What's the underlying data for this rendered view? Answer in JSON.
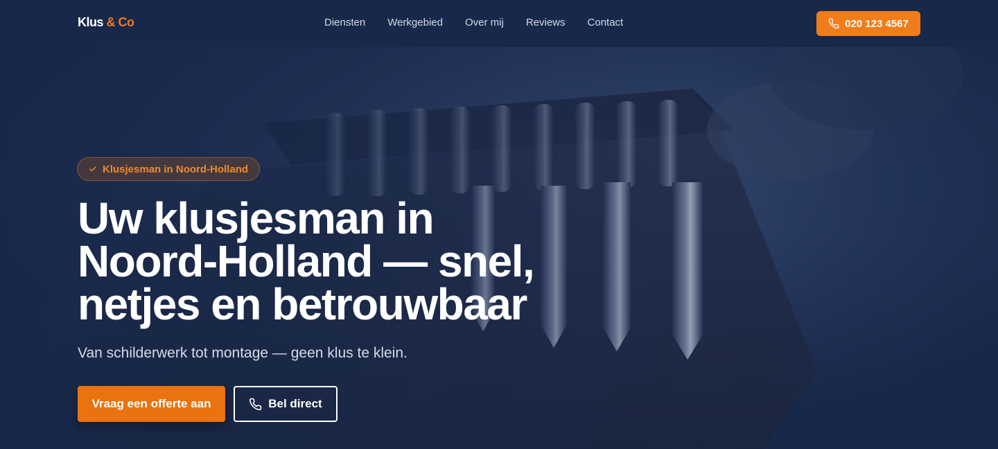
{
  "brand": {
    "logo_main": "Klus",
    "logo_accent": "& Co",
    "accent_color": "#f07c1a",
    "navy_color": "#17284a"
  },
  "nav": {
    "links": [
      "Diensten",
      "Werkgebied",
      "Over mij",
      "Reviews",
      "Contact"
    ],
    "phone_label": "020 123 4567",
    "phone_icon": "phone-icon"
  },
  "hero": {
    "badge": "Klusjesman in Noord-Holland",
    "badge_icon": "check-icon",
    "headline": "Uw klusjesman in Noord-Holland — snel, netjes en betrouwbaar",
    "subline": "Van schilderwerk tot montage — geen klus te klein.",
    "cta_primary": "Vraag een offerte aan",
    "cta_secondary": "Bel direct",
    "cta_secondary_icon": "phone-icon",
    "background": "screwdriver-bits-photo"
  }
}
